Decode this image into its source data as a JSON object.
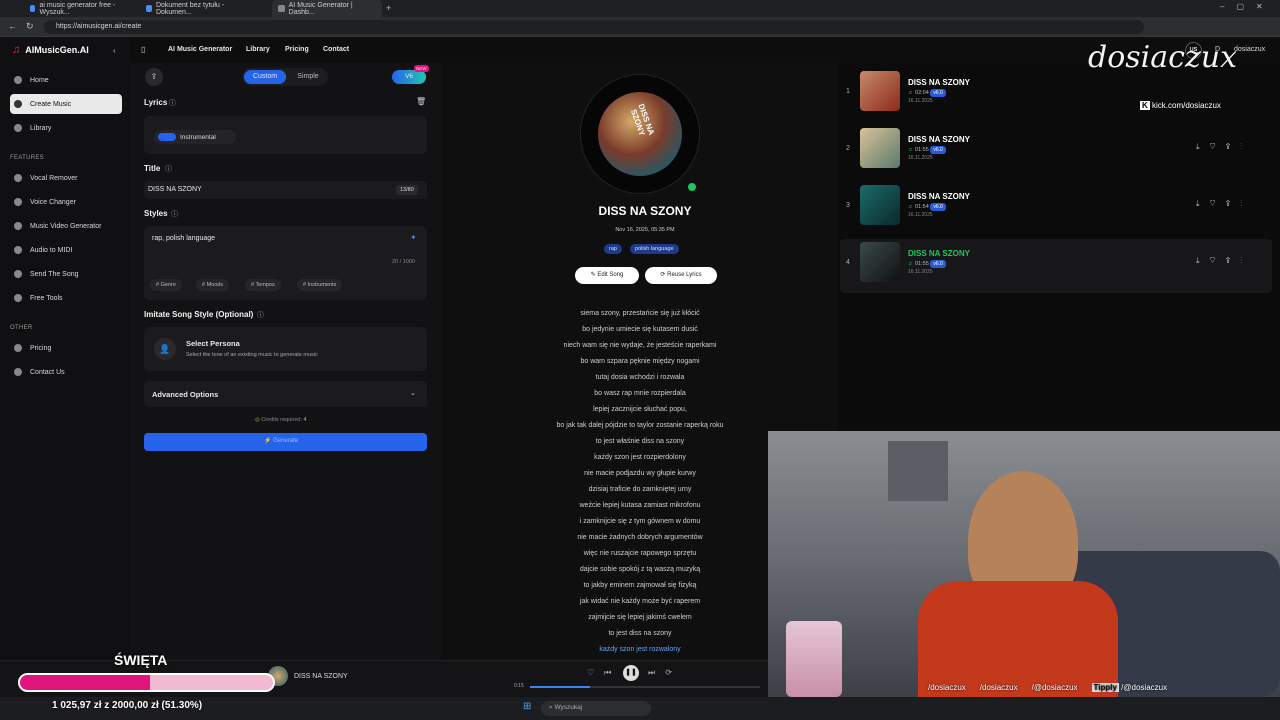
{
  "browser": {
    "tabs": [
      {
        "label": "ai music generator free - Wyszuk..."
      },
      {
        "label": "Dokument bez tytułu - Dokumen..."
      },
      {
        "label": "AI Music Generator | Dashb..."
      }
    ],
    "url": "https://aimusicgen.ai/create"
  },
  "sidebar": {
    "brand": "AIMusicGen.AI",
    "items": [
      {
        "label": "Home"
      },
      {
        "label": "Create Music"
      },
      {
        "label": "Library"
      }
    ],
    "features_title": "FEATURES",
    "features": [
      {
        "label": "Vocal Remover"
      },
      {
        "label": "Voice Changer"
      },
      {
        "label": "Music Video Generator"
      },
      {
        "label": "Audio to MIDI"
      },
      {
        "label": "Send The Song"
      },
      {
        "label": "Free Tools"
      }
    ],
    "other_title": "OTHER",
    "other": [
      {
        "label": "Pricing"
      },
      {
        "label": "Contact Us"
      }
    ]
  },
  "topnav": {
    "links": [
      "AI Music Generator",
      "Library",
      "Pricing",
      "Contact"
    ],
    "user_badge": "US",
    "user_initial": "D",
    "user_name": "dosiaczux"
  },
  "form": {
    "mode_custom": "Custom",
    "mode_simple": "Simple",
    "version": "V6",
    "version_tag": "NEW",
    "lyrics_label": "Lyrics",
    "instrumental_label": "Instrumental",
    "title_label": "Title",
    "title_value": "DISS NA SZONY",
    "title_count": "13/80",
    "styles_label": "Styles",
    "styles_value": "rap, polish language",
    "styles_count": "20 / 1000",
    "style_chips": [
      "# Genre",
      "# Moods",
      "# Tempos",
      "# Instruments"
    ],
    "imitate_label": "Imitate Song Style (Optional)",
    "persona_title": "Select Persona",
    "persona_desc": "Select the tone of an existing music to generate music",
    "advanced_label": "Advanced Options",
    "credits_label": "Credits required:",
    "credits_value": "4",
    "generate_label": "Generate"
  },
  "song_detail": {
    "cover_text": "DISS NA SZONY",
    "title": "DISS NA SZONY",
    "date": "Nov 16, 2025, 05:35 PM",
    "tags": [
      "rap",
      "polish language"
    ],
    "edit_label": "Edit Song",
    "reuse_label": "Reuse Lyrics",
    "lyrics": [
      "siema szony, przestańcie się już kłócić",
      "bo jedynie umiecie się kutasem dusić",
      "niech wam się nie wydaje, że jesteście raperkami",
      "bo wam szpara pęknie między nogami",
      "tutaj dosia wchodzi i rozwala",
      "bo wasz rap mnie rozpierdala",
      "lepiej zacznijcie słuchać popu,",
      "bo jak tak dalej pójdzie to taylor zostanie raperką roku",
      "to jest właśnie diss na szony",
      "każdy szon jest rozpierdolony",
      "nie macie podjazdu wy głupie kurwy",
      "dzisiaj traficie do zamkniętej urny",
      "weźcie lepiej kutasa zamiast mikrofonu",
      "i zamknijcie się z tym gównem w domu",
      "nie macie żadnych dobrych argumentów",
      "więc nie ruszajcie rapowego sprzętu",
      "dajcie sobie spokój z tą waszą muzyką",
      "to jakby eminem zajmował się fizyką",
      "jak widać nie każdy może być raperem",
      "zajmijcie się lepiej jakimś cwelem",
      "to jest diss na szony",
      "każdy szon jest rozwalony"
    ]
  },
  "song_list": [
    {
      "index": "1",
      "title": "DISS NA SZONY",
      "duration": "02:04",
      "version": "v6.0",
      "date": "16.11.2025"
    },
    {
      "index": "2",
      "title": "DISS NA SZONY",
      "duration": "01:55",
      "version": "v6.0",
      "date": "16.11.2025"
    },
    {
      "index": "3",
      "title": "DISS NA SZONY",
      "duration": "01:54",
      "version": "v6.0",
      "date": "16.11.2025"
    },
    {
      "index": "4",
      "title": "DISS NA SZONY",
      "duration": "01:55",
      "version": "v6.0",
      "date": "16.11.2025"
    }
  ],
  "player": {
    "title": "DISS NA SZONY",
    "time": "0:15",
    "progress": 0.26
  },
  "overlay": {
    "watermark": "dosiaczux",
    "kick_url": "kick.com/dosiaczux",
    "goal_label": "ŚWIĘTA",
    "goal_text": "1 025,97 zł z 2000,00 zł (51.30%)",
    "goal_progress": 0.513,
    "socials": [
      "/dosiaczux",
      "/dosiaczux",
      "/@dosiaczux",
      "/@dosiaczux"
    ],
    "tipply": "Tipply"
  },
  "taskbar": {
    "search": "Wyszukaj"
  },
  "colors": {
    "accent": "#2563eb",
    "playing": "#22c55e",
    "goal": "#e0157b"
  }
}
